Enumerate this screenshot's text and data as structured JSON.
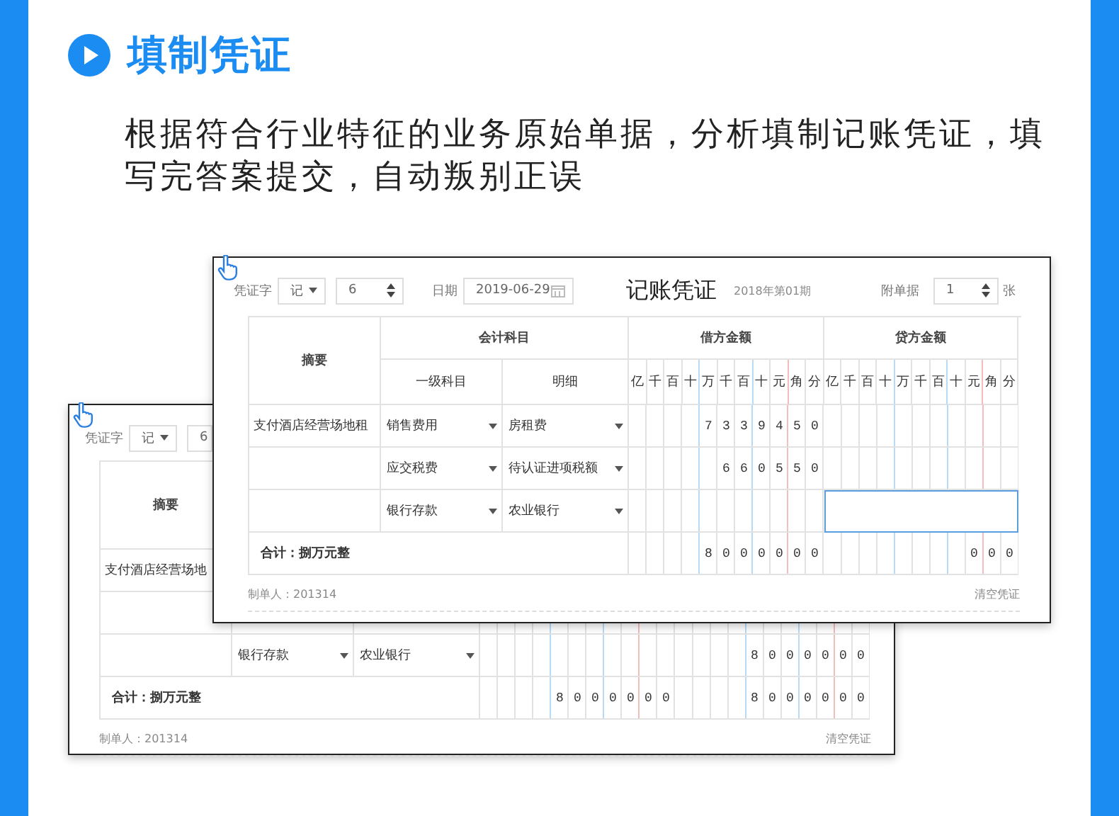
{
  "header": {
    "title": "填制凭证"
  },
  "description": "根据符合行业特征的业务原始单据，分析填制记账凭证，填写完答案提交，自动叛别正误",
  "vouchers": [
    {
      "toolbar": {
        "type_label": "凭证字",
        "type": "记",
        "number": "6"
      },
      "table": {
        "header": {
          "summary": "摘要"
        },
        "rows": [
          {
            "summary": "支付酒店经营场地",
            "focused": false
          },
          {
            "focused": false
          },
          {
            "subject": "银行存款",
            "detail": "农业银行",
            "credit": "8000000",
            "focused": false
          }
        ],
        "total": {
          "label": "合计：捌万元整",
          "debit": "8000000",
          "credit": "8000000"
        }
      },
      "footer": {
        "maker": "制单人：201314",
        "clear": "清空凭证"
      }
    },
    {
      "toolbar": {
        "type_label": "凭证字",
        "type": "记",
        "number": "6",
        "date_label": "日期",
        "date": "2019-06-29",
        "title": "记账凭证",
        "period": "2018年第01期",
        "attach_label": "附单据",
        "attach": "1",
        "attach_unit": "张"
      },
      "table": {
        "header": {
          "summary": "摘要",
          "subjects": "会计科目",
          "subject": "一级科目",
          "detail": "明细",
          "debit": "借方金额",
          "credit": "贷方金额",
          "debit_digits": [
            "亿",
            "千",
            "百",
            "十",
            "万",
            "千",
            "百",
            "十",
            "元",
            "角",
            "分"
          ],
          "credit_digits": [
            "亿",
            "千",
            "百",
            "十",
            "万",
            "千",
            "百",
            "十",
            "元",
            "角",
            "分"
          ]
        },
        "rows": [
          {
            "summary": "支付酒店经营场地租",
            "subject": "销售费用",
            "detail": "房租费",
            "debit": "7339450",
            "focused": false
          },
          {
            "subject": "应交税费",
            "detail": "待认证进项税额",
            "debit": "660550",
            "focused": false
          },
          {
            "subject": "银行存款",
            "detail": "农业银行",
            "focused": true
          }
        ],
        "total": {
          "label": "合计：捌万元整",
          "debit": "8000000",
          "credit": "000"
        }
      },
      "footer": {
        "maker": "制单人：201314",
        "clear": "清空凭证"
      }
    }
  ]
}
